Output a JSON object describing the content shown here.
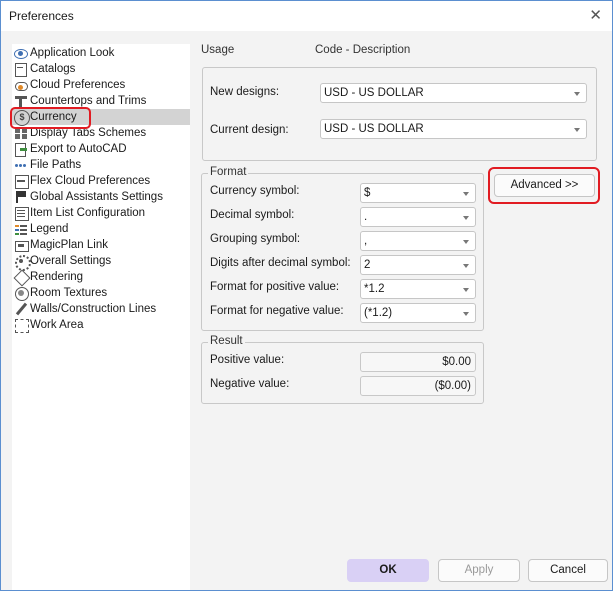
{
  "window": {
    "title": "Preferences",
    "close_glyph": "✕"
  },
  "tree": {
    "items": [
      {
        "label": "Application Look",
        "icon": "eye-icon"
      },
      {
        "label": "Catalogs",
        "icon": "book-icon"
      },
      {
        "label": "Cloud Preferences",
        "icon": "cloud-icon"
      },
      {
        "label": "Countertops and Trims",
        "icon": "countertop-icon"
      },
      {
        "label": "Currency",
        "icon": "dollar-icon",
        "selected": true
      },
      {
        "label": "Display Tabs Schemes",
        "icon": "tabs-icon"
      },
      {
        "label": "Export to AutoCAD",
        "icon": "export-icon"
      },
      {
        "label": "File Paths",
        "icon": "dots-icon"
      },
      {
        "label": "Flex Cloud Preferences",
        "icon": "flex-cloud-icon"
      },
      {
        "label": "Global Assistants Settings",
        "icon": "flag-icon"
      },
      {
        "label": "Item List Configuration",
        "icon": "list-icon"
      },
      {
        "label": "Legend",
        "icon": "legend-icon"
      },
      {
        "label": "MagicPlan Link",
        "icon": "magicplan-icon"
      },
      {
        "label": "Overall Settings",
        "icon": "gear-icon"
      },
      {
        "label": "Rendering",
        "icon": "cube-icon"
      },
      {
        "label": "Room Textures",
        "icon": "texture-icon"
      },
      {
        "label": "Walls/Construction Lines",
        "icon": "pencil-icon"
      },
      {
        "label": "Work Area",
        "icon": "work-area-icon"
      }
    ]
  },
  "usage": {
    "header_usage": "Usage",
    "header_code": "Code - Description",
    "new_designs_label": "New designs:",
    "new_designs_value": "USD - US DOLLAR",
    "current_design_label": "Current design:",
    "current_design_value": "USD - US DOLLAR"
  },
  "format": {
    "group_label": "Format",
    "currency_symbol_label": "Currency symbol:",
    "currency_symbol_value": "$",
    "decimal_symbol_label": "Decimal symbol:",
    "decimal_symbol_value": ".",
    "grouping_symbol_label": "Grouping symbol:",
    "grouping_symbol_value": ",",
    "digits_label": "Digits after decimal symbol:",
    "digits_value": "2",
    "positive_format_label": "Format for positive value:",
    "positive_format_value": "*1.2",
    "negative_format_label": "Format for negative value:",
    "negative_format_value": "(*1.2)"
  },
  "result": {
    "group_label": "Result",
    "positive_label": "Positive value:",
    "positive_value": "$0.00",
    "negative_label": "Negative value:",
    "negative_value": "($0.00)"
  },
  "buttons": {
    "advanced": "Advanced >>",
    "ok": "OK",
    "apply": "Apply",
    "cancel": "Cancel"
  },
  "colors": {
    "highlight": "#e11b22",
    "ok_button": "#d9d0f5",
    "window_border": "#5b8fd0"
  }
}
